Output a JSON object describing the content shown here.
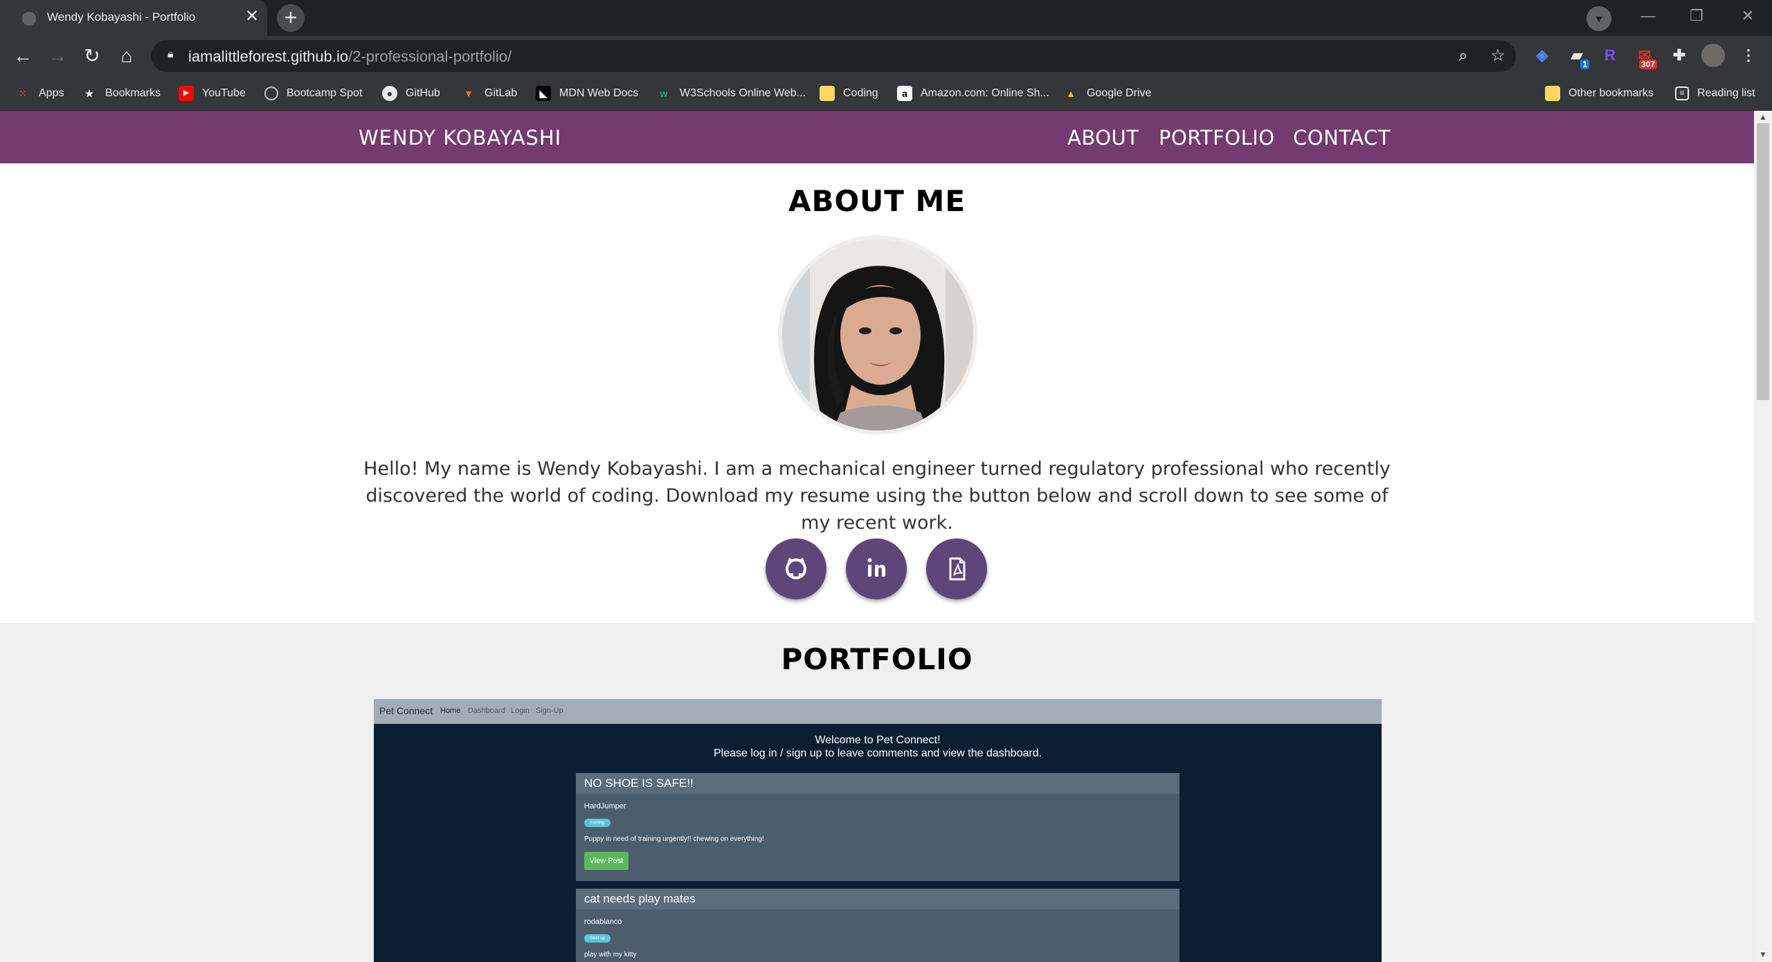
{
  "browser": {
    "tab_title": "Wendy Kobayashi - Portfolio",
    "url_host": "iamalittleforest.github.io",
    "url_path": "/2-professional-portfolio/",
    "extensions": {
      "badge_blue": "1",
      "badge_red": "307",
      "letter_r": "R"
    },
    "bookmarks": [
      {
        "label": "Apps",
        "icon": "apps-grid-icon"
      },
      {
        "label": "Bookmarks",
        "icon": "star-icon"
      },
      {
        "label": "YouTube",
        "icon": "youtube-icon"
      },
      {
        "label": "Bootcamp Spot",
        "icon": "globe-icon"
      },
      {
        "label": "GitHub",
        "icon": "github-icon"
      },
      {
        "label": "GitLab",
        "icon": "gitlab-icon"
      },
      {
        "label": "MDN Web Docs",
        "icon": "mdn-icon"
      },
      {
        "label": "W3Schools Online Web...",
        "icon": "w3schools-icon"
      },
      {
        "label": "Coding",
        "icon": "folder-icon"
      },
      {
        "label": "Amazon.com: Online Sh...",
        "icon": "amazon-icon"
      },
      {
        "label": "Google Drive",
        "icon": "google-drive-icon"
      }
    ],
    "other_bookmarks": "Other bookmarks",
    "reading_list": "Reading list"
  },
  "site": {
    "brand": "WENDY KOBAYASHI",
    "nav": [
      "ABOUT",
      "PORTFOLIO",
      "CONTACT"
    ],
    "about": {
      "heading": "ABOUT ME",
      "bio": "Hello! My name is Wendy Kobayashi. I am a mechanical engineer turned regulatory professional who recently discovered the world of coding. Download my resume using the button below and scroll down to see some of my recent work.",
      "social": [
        "github-icon",
        "linkedin-icon",
        "pdf-file-icon"
      ]
    },
    "portfolio": {
      "heading": "PORTFOLIO",
      "project": {
        "brand": "Pet Connect",
        "nav": [
          "Home",
          "Dashboard",
          "Login",
          "Sign-Up"
        ],
        "welcome_line1": "Welcome to Pet Connect!",
        "welcome_line2": "Please log in / sign up to leave comments and view the dashboard.",
        "posts": [
          {
            "title": "NO SHOE IS SAFE!!",
            "user": "HardJumper",
            "tag": "training",
            "body": "Puppy in need of training urgently!! chewing on everything!",
            "button": "View Post"
          },
          {
            "title": "cat needs play mates",
            "user": "rodablanco",
            "tag": "meet-up",
            "body": "play with my kitty"
          }
        ]
      }
    }
  },
  "colors": {
    "nav_bg": "#733b6f",
    "social_bg": "#5e467a",
    "project_bg": "#0c1e32"
  }
}
